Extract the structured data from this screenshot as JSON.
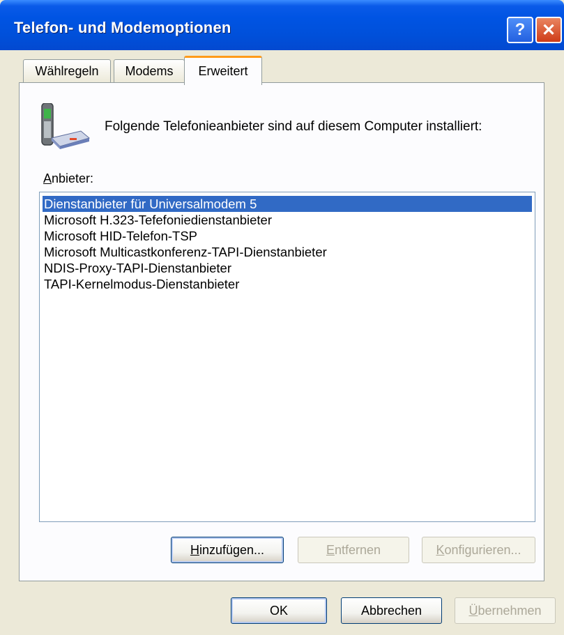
{
  "window": {
    "title": "Telefon- und Modemoptionen",
    "help_glyph": "?",
    "close_glyph": "✕"
  },
  "tabs": [
    {
      "label": "Wählregeln"
    },
    {
      "label": "Modems"
    },
    {
      "label": "Erweitert"
    }
  ],
  "panel": {
    "intro_text": "Folgende Telefonieanbieter sind auf diesem Computer installiert:",
    "list_label_first": "A",
    "list_label_rest": "nbieter:",
    "providers": [
      "Dienstanbieter für Universalmodem 5",
      "Microsoft H.323-Tefefoniedienstanbieter",
      "Microsoft HID-Telefon-TSP",
      "Microsoft Multicastkonferenz-TAPI-Dienstanbieter",
      "NDIS-Proxy-TAPI-Dienstanbieter",
      "TAPI-Kernelmodus-Dienstanbieter"
    ],
    "selected_index": 0,
    "add_first": "H",
    "add_rest": "inzufügen...",
    "remove_first": "E",
    "remove_rest": "ntfernen",
    "configure_first": "K",
    "configure_rest": "onfigurieren..."
  },
  "footer": {
    "ok_label": "OK",
    "cancel_label": "Abbrechen",
    "apply_first": "Ü",
    "apply_rest": "bernehmen"
  },
  "colors": {
    "titlebar": "#0054e3",
    "selection": "#316ac5",
    "tab_highlight": "#ff9b1a",
    "dialog_bg": "#ece9d8"
  }
}
